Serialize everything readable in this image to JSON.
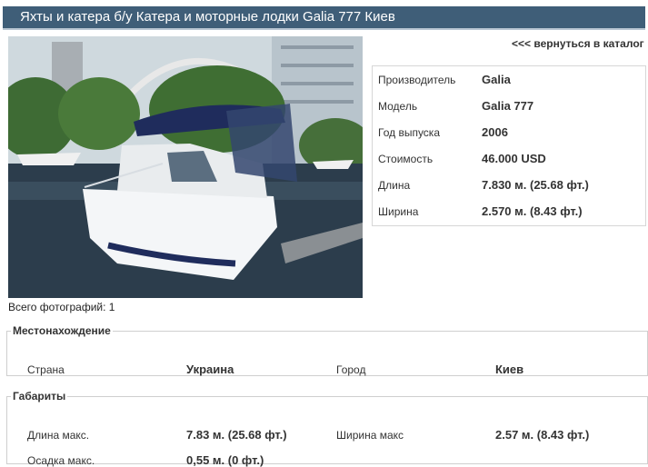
{
  "page_title": "Яхты и катера б/у Катера и моторные лодки Galia 777 Киев",
  "back_link": "<<< вернуться в каталог",
  "photo_caption": "Всего фотографий: 1",
  "specs": [
    {
      "label": "Производитель",
      "value": "Galia"
    },
    {
      "label": "Модель",
      "value": "Galia 777"
    },
    {
      "label": "Год выпуска",
      "value": "2006"
    },
    {
      "label": "Стоимость",
      "value": "46.000 USD"
    },
    {
      "label": "Длина",
      "value": "7.830 м. (25.68 фт.)"
    },
    {
      "label": "Ширина",
      "value": "2.570 м. (8.43 фт.)"
    }
  ],
  "location": {
    "title": "Местонахождение",
    "country_label": "Страна",
    "country_value": "Украина",
    "city_label": "Город",
    "city_value": "Киев"
  },
  "dimensions": {
    "title": "Габариты",
    "max_length_label": "Длина макс.",
    "max_length_value": "7.83 м. (25.68 фт.)",
    "max_width_label": "Ширина макс",
    "max_width_value": "2.57 м. (8.43 фт.)",
    "max_draft_label": "Осадка макс.",
    "max_draft_value": "0,55 м. (0 фт.)"
  },
  "colors": {
    "title_bar": "#3f5e78",
    "hull": "#f4f6f8",
    "canopy": "#1f2c5c",
    "water": "#2c3d4c"
  }
}
